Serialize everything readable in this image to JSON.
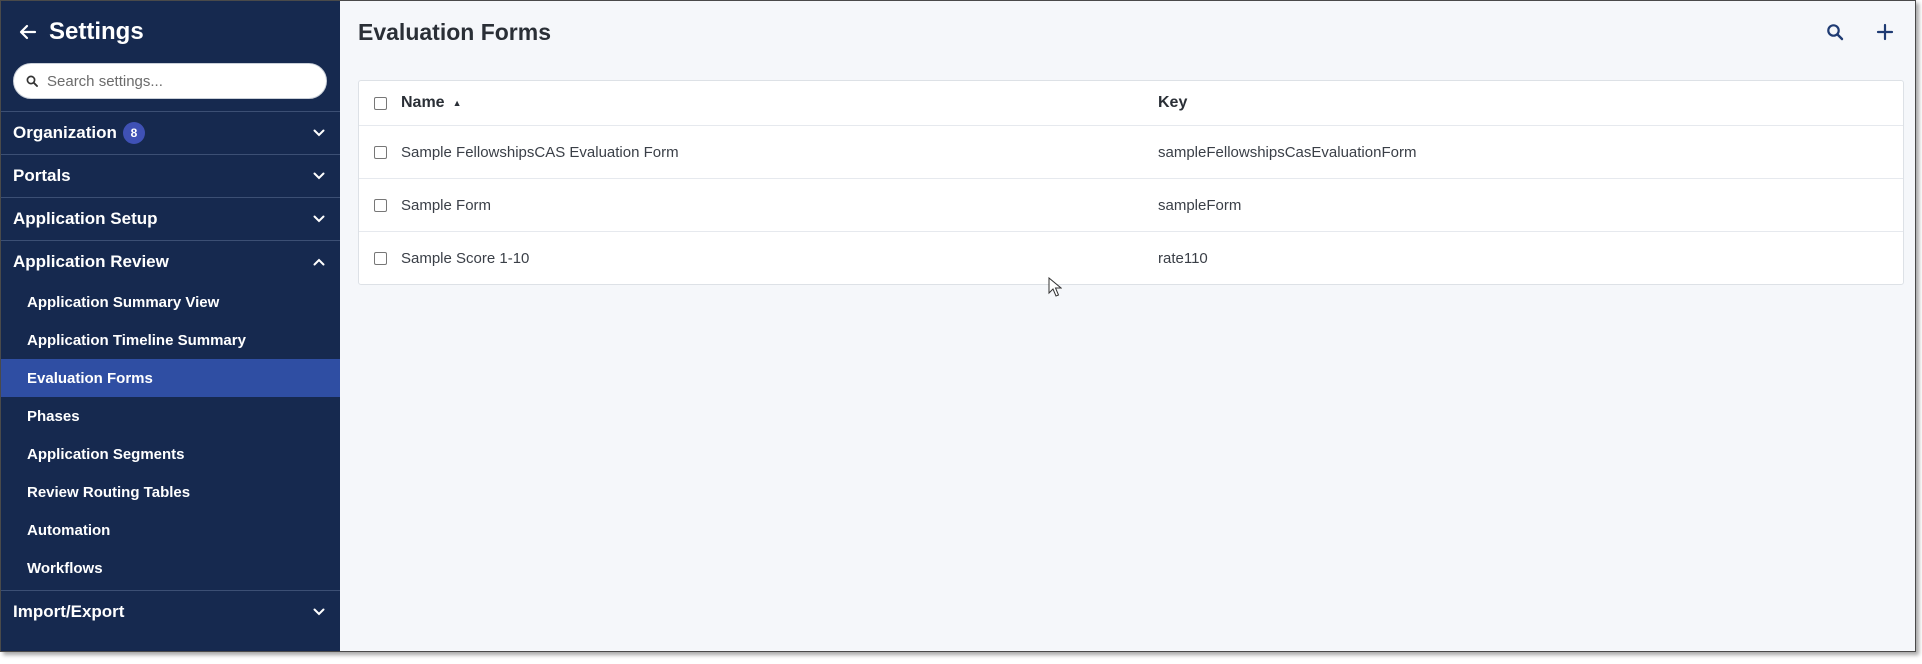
{
  "sidebar": {
    "title": "Settings",
    "search_placeholder": "Search settings...",
    "sections": [
      {
        "label": "Organization",
        "badge": "8",
        "expanded": false
      },
      {
        "label": "Portals",
        "expanded": false
      },
      {
        "label": "Application Setup",
        "expanded": false
      },
      {
        "label": "Application Review",
        "expanded": true
      },
      {
        "label": "Import/Export",
        "expanded": false
      }
    ],
    "review_items": [
      {
        "label": "Application Summary View"
      },
      {
        "label": "Application Timeline Summary"
      },
      {
        "label": "Evaluation Forms",
        "active": true
      },
      {
        "label": "Phases"
      },
      {
        "label": "Application Segments"
      },
      {
        "label": "Review Routing Tables"
      },
      {
        "label": "Automation"
      },
      {
        "label": "Workflows"
      }
    ]
  },
  "main": {
    "title": "Evaluation Forms",
    "table": {
      "columns": [
        "Name",
        "Key"
      ],
      "sort_indicator": "▲",
      "rows": [
        {
          "name": "Sample FellowshipsCAS Evaluation Form",
          "key": "sampleFellowshipsCasEvaluationForm"
        },
        {
          "name": "Sample Form",
          "key": "sampleForm"
        },
        {
          "name": "Sample Score 1-10",
          "key": "rate110"
        }
      ]
    }
  },
  "colors": {
    "sidebar_bg": "#16294f",
    "active_item_bg": "#2f4ea3",
    "badge_bg": "#3f51b5",
    "main_bg": "#f5f7fa"
  },
  "icons": {
    "back": "arrow-left-icon",
    "search": "search-icon",
    "add": "plus-icon",
    "chevron_down": "chevron-down-icon",
    "chevron_up": "chevron-up-icon"
  }
}
